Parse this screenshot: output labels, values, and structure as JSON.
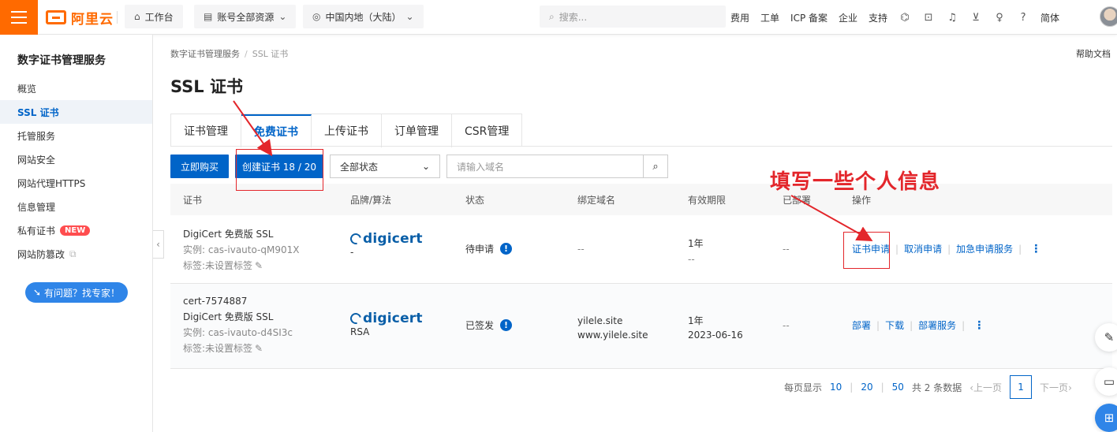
{
  "topbar": {
    "logo": "阿里云",
    "workbench": "工作台",
    "resources": "账号全部资源",
    "region": "中国内地（大陆）",
    "search_placeholder": "搜索...",
    "links": [
      "费用",
      "工单",
      "ICP 备案",
      "企业",
      "支持"
    ],
    "lang": "简体"
  },
  "sidebar": {
    "title": "数字证书管理服务",
    "items": [
      {
        "label": "概览"
      },
      {
        "label": "SSL 证书"
      },
      {
        "label": "托管服务"
      },
      {
        "label": "网站安全"
      },
      {
        "label": "网站代理HTTPS"
      },
      {
        "label": "信息管理"
      },
      {
        "label": "私有证书",
        "badge": "NEW"
      },
      {
        "label": "网站防篡改"
      }
    ],
    "help_button": "有问题？找专家！"
  },
  "main": {
    "breadcrumb": [
      "数字证书管理服务",
      "SSL 证书"
    ],
    "help_doc": "帮助文档",
    "title": "SSL 证书",
    "tabs": [
      "证书管理",
      "免费证书",
      "上传证书",
      "订单管理",
      "CSR管理"
    ],
    "buy_button": "立即购买",
    "create_button": "创建证书 18 / 20",
    "status_select": "全部状态",
    "domain_placeholder": "请输入域名",
    "columns": [
      "证书",
      "品牌/算法",
      "状态",
      "绑定域名",
      "有效期限",
      "已部署",
      "操作"
    ],
    "rows": [
      {
        "name": "DigiCert 免费版 SSL",
        "instance": "实例: cas-ivauto-qM901X",
        "tag": "标签:未设置标签",
        "brand": "digicert",
        "algo": "-",
        "status": "待申请",
        "domain1": "--",
        "period": "1年",
        "expire": "--",
        "deployed": "--",
        "actions": [
          "证书申请",
          "取消申请",
          "加急申请服务"
        ]
      },
      {
        "id": "cert-7574887",
        "name": "DigiCert 免费版 SSL",
        "instance": "实例: cas-ivauto-d4SI3c",
        "tag": "标签:未设置标签",
        "brand": "digicert",
        "algo": "RSA",
        "status": "已签发",
        "domain1": "yilele.site",
        "domain2": "www.yilele.site",
        "period": "1年",
        "expire": "2023-06-16",
        "deployed": "--",
        "actions": [
          "部署",
          "下载",
          "部署服务"
        ]
      }
    ],
    "pager": {
      "page_size_label": "每页显示",
      "sizes": [
        "10",
        "20",
        "50"
      ],
      "total": "共 2 条数据",
      "prev": "上一页",
      "current": "1",
      "next": "下一页"
    }
  },
  "annotation": {
    "text": "填写一些个人信息",
    "color": "#e3262b"
  }
}
